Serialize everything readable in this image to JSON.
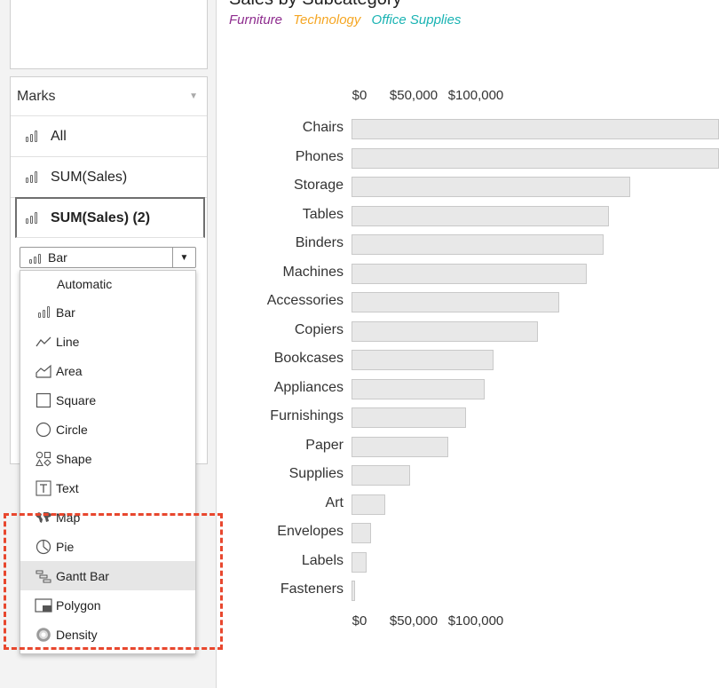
{
  "sheet": {
    "title": "Sales by Subcategory",
    "legend": [
      {
        "label": "Furniture",
        "color": "#8e2c8e"
      },
      {
        "label": "Technology",
        "color": "#f5a623"
      },
      {
        "label": "Office Supplies",
        "color": "#1ab3b3"
      }
    ]
  },
  "marks": {
    "header": "Marks",
    "rows": [
      "All",
      "SUM(Sales)",
      "SUM(Sales) (2)"
    ],
    "mark_type": {
      "selected": "Bar",
      "options": [
        {
          "label": "Automatic",
          "icon": ""
        },
        {
          "label": "Bar",
          "icon": "bar-icon"
        },
        {
          "label": "Line",
          "icon": "line-icon"
        },
        {
          "label": "Area",
          "icon": "area-icon"
        },
        {
          "label": "Square",
          "icon": "square-icon"
        },
        {
          "label": "Circle",
          "icon": "circle-icon"
        },
        {
          "label": "Shape",
          "icon": "shape-icon"
        },
        {
          "label": "Text",
          "icon": "text-icon"
        },
        {
          "label": "Map",
          "icon": "map-icon"
        },
        {
          "label": "Pie",
          "icon": "pie-icon"
        },
        {
          "label": "Gantt Bar",
          "icon": "gantt-bar-icon",
          "hovered": true
        },
        {
          "label": "Polygon",
          "icon": "polygon-icon"
        },
        {
          "label": "Density",
          "icon": "density-icon"
        }
      ]
    }
  },
  "chart_data": {
    "type": "bar",
    "orientation": "horizontal",
    "x_ticks": [
      "$0",
      "$50,000",
      "$100,000"
    ],
    "x_tick_values": [
      0,
      50000,
      100000
    ],
    "categories": [
      "Chairs",
      "Phones",
      "Storage",
      "Tables",
      "Binders",
      "Machines",
      "Accessories",
      "Copiers",
      "Bookcases",
      "Appliances",
      "Furnishings",
      "Paper",
      "Supplies",
      "Art",
      "Envelopes",
      "Labels",
      "Fasteners"
    ],
    "values": [
      328000,
      330000,
      224000,
      207000,
      203000,
      189000,
      167000,
      150000,
      114000,
      107000,
      92000,
      78000,
      47000,
      27000,
      16000,
      12000,
      3000
    ],
    "grid": false
  }
}
